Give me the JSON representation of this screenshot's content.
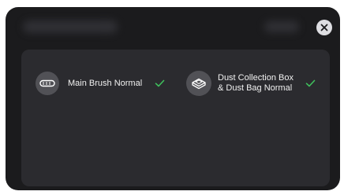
{
  "colors": {
    "modal_background": "#1b1b1d",
    "panel_background": "#2b2b2f",
    "icon_background": "#515156",
    "check_color": "#3fbf5c",
    "close_button_background": "#dedee2"
  },
  "dialog": {
    "close_icon": "close-icon"
  },
  "status_items": [
    {
      "icon": "main-brush-icon",
      "label": "Main Brush Normal",
      "status_icon": "checkmark-icon"
    },
    {
      "icon": "dust-box-icon",
      "label": "Dust Collection Box\n& Dust Bag Normal",
      "status_icon": "checkmark-icon"
    }
  ]
}
